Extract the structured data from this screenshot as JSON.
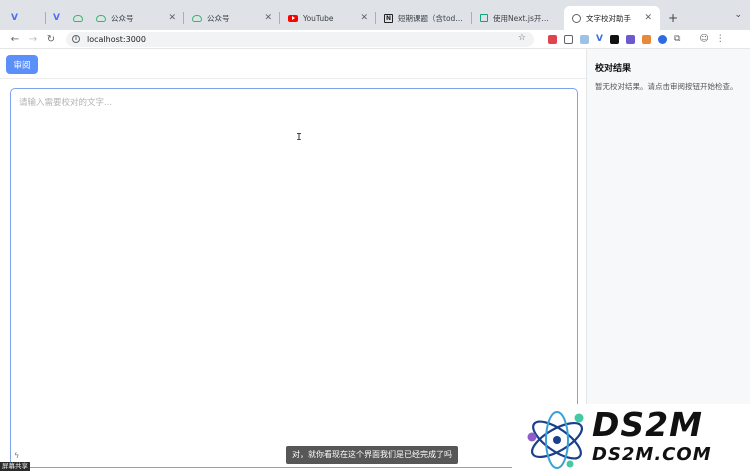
{
  "browser": {
    "tabs": [
      {
        "title": "",
        "icon": "v-icon"
      },
      {
        "title": "",
        "icon": "v-icon"
      },
      {
        "title": "公众号",
        "icon": "cloud-icon"
      },
      {
        "title": "公众号",
        "icon": "cloud-icon"
      },
      {
        "title": "YouTube",
        "icon": "youtube-icon"
      },
      {
        "title": "短期课题（含todo li",
        "icon": "notion-icon"
      },
      {
        "title": "使用Next.js开发网站",
        "icon": "chatgpt-icon"
      },
      {
        "title": "文字校对助手",
        "icon": "globe-icon",
        "active": true
      }
    ],
    "new_tab": "+",
    "url": "localhost:3000"
  },
  "app": {
    "review_button": "审阅",
    "editor_placeholder": "请输入需要校对的文字...",
    "sidebar_title": "校对结果",
    "sidebar_empty": "暂无校对结果。请点击审阅按钮开始检查。"
  },
  "overlay": {
    "subtitle": "对，就你看现在这个界面我们是已经完成了吗",
    "share_label": "屏幕共享",
    "logo_main": "DS2M",
    "logo_sub": "DS2M.COM"
  },
  "colors": {
    "accent": "#5b8ff9",
    "border_focus": "#7ea2ec",
    "sidebar_bg": "#f6f8fa"
  }
}
